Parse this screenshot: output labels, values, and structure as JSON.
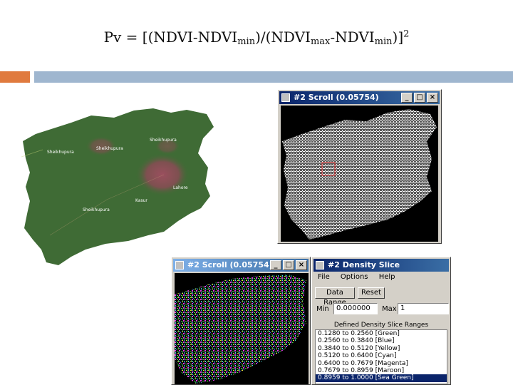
{
  "title": {
    "p1": "Pv  = [(NDVI-NDVI",
    "s1": "min",
    "p2": ")/(NDVI",
    "s2": "max",
    "p3": "-NDVI",
    "s3": "min",
    "p4": ")]",
    "sup": "2"
  },
  "map": {
    "places": [
      "Sheikhupura",
      "Sheikhupura",
      "Sheikhupura",
      "Lahore",
      "Kasur",
      "Sheikhupura"
    ]
  },
  "scroll_window": {
    "title": "#2 Scroll (0.05754)"
  },
  "color_window": {
    "title": "#2 Scroll (0.05754)"
  },
  "density_window": {
    "title": "#2 Density Slice",
    "menu": [
      "File",
      "Options",
      "Help"
    ],
    "data_range_label": "Data Range",
    "reset_label": "Reset",
    "min_label": "Min",
    "min_value": "0.000000",
    "max_label": "Max",
    "max_value": "1",
    "ranges_header": "Defined Density Slice Ranges",
    "ranges": [
      "0.1280 to 0.2560 [Green]",
      "0.2560 to 0.3840 [Blue]",
      "0.3840 to 0.5120 [Yellow]",
      "0.5120 to 0.6400 [Cyan]",
      "0.6400 to 0.7679 [Magenta]",
      "0.7679 to 0.8959 [Maroon]",
      "0.8959 to 1.0000 [Sea Green]"
    ],
    "selected_index": 6
  },
  "colors": {
    "accent_orange": "#e07a3e",
    "accent_blue": "#9fb6cf",
    "titlebar": "#0a246a",
    "map_green": "#3f6b35",
    "urban": "#8c4a55"
  }
}
